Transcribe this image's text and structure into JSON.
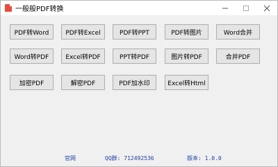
{
  "window": {
    "title": "一般般PDF转换"
  },
  "buttons": {
    "row1": [
      "PDF转Word",
      "PDF转Excel",
      "PDF转PPT",
      "PDF转图片",
      "Word合并"
    ],
    "row2": [
      "Word转PDF",
      "Excel转PDF",
      "PPT转PDF",
      "图片转PDF",
      "合并PDF"
    ],
    "row3": [
      "加密PDF",
      "解密PDF",
      "PDF加水印",
      "Excel转Html"
    ]
  },
  "status": {
    "website": "官网",
    "qq": "QQ群: 712492536",
    "version": "版本: 1.0.0"
  },
  "colors": {
    "status_text": "#1a3ea6",
    "button_bg": "#e5e5e5",
    "window_bg": "#f0f0f0"
  }
}
